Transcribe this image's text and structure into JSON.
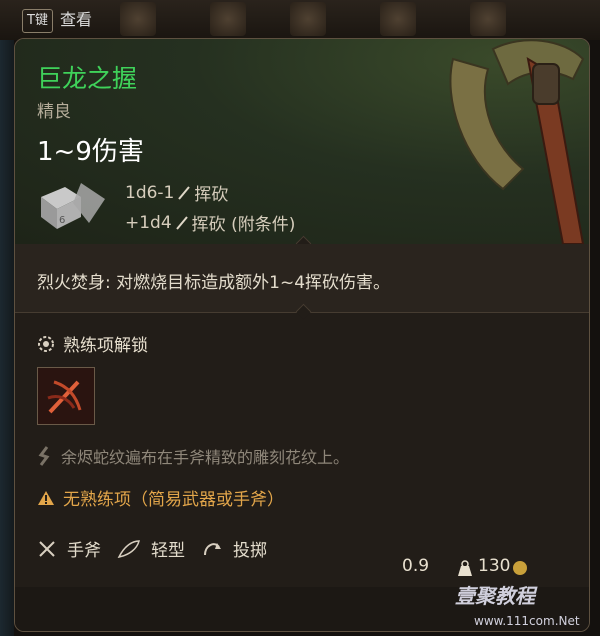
{
  "topbar": {
    "key_label": "T键",
    "view_label": "查看"
  },
  "item": {
    "name": "巨龙之握",
    "rarity": "精良",
    "damage_range": "1~9伤害",
    "damage_lines": [
      {
        "dice": "1d6-1",
        "type": "挥砍"
      },
      {
        "dice": "+1d4",
        "type": "挥砍 (附条件)"
      }
    ],
    "effect": "烈火焚身: 对燃烧目标造成额外1~4挥砍伤害。",
    "proficiency_unlock": "熟练项解锁",
    "lore": "余烬蛇纹遍布在手斧精致的雕刻花纹上。",
    "proficiency_warning": "无熟练项（简易武器或手斧）",
    "properties": [
      "手斧",
      "轻型",
      "投掷"
    ],
    "weight": "0.9",
    "price": "130"
  },
  "watermark": {
    "text": "壹聚教程",
    "url": "www.111com.Net"
  },
  "colors": {
    "name": "#3fd25a",
    "warning": "#e3a64a",
    "panel": "#221d18"
  }
}
